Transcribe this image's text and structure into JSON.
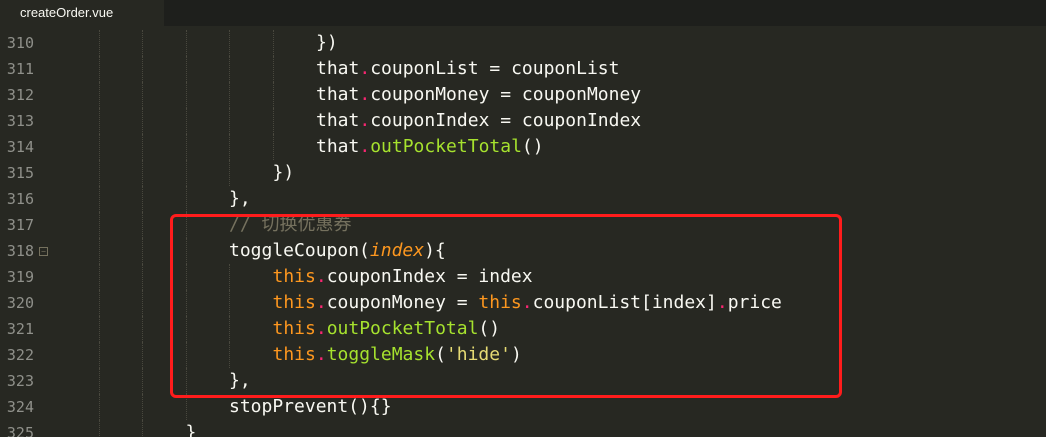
{
  "tab": {
    "label": "createOrder.vue"
  },
  "line_numbers": [
    "310",
    "311",
    "312",
    "313",
    "314",
    "315",
    "316",
    "317",
    "318",
    "319",
    "320",
    "321",
    "322",
    "323",
    "324",
    "325"
  ],
  "fold_line": "318",
  "colors": {
    "background": "#272822",
    "highlight_border": "#ff1c1c",
    "keyword": "#fd971f",
    "function": "#a6e22e",
    "operator": "#f92672",
    "string": "#e6db74",
    "comment": "#75715e"
  },
  "code_lines": [
    {
      "indent": 6,
      "tokens": [
        {
          "t": "plain",
          "v": "})"
        }
      ]
    },
    {
      "indent": 6,
      "tokens": [
        {
          "t": "plain",
          "v": "that"
        },
        {
          "t": "punct",
          "v": "."
        },
        {
          "t": "plain",
          "v": "couponList = couponList"
        }
      ]
    },
    {
      "indent": 6,
      "tokens": [
        {
          "t": "plain",
          "v": "that"
        },
        {
          "t": "punct",
          "v": "."
        },
        {
          "t": "plain",
          "v": "couponMoney = couponMoney"
        }
      ]
    },
    {
      "indent": 6,
      "tokens": [
        {
          "t": "plain",
          "v": "that"
        },
        {
          "t": "punct",
          "v": "."
        },
        {
          "t": "plain",
          "v": "couponIndex = couponIndex"
        }
      ]
    },
    {
      "indent": 6,
      "tokens": [
        {
          "t": "plain",
          "v": "that"
        },
        {
          "t": "punct",
          "v": "."
        },
        {
          "t": "func",
          "v": "outPocketTotal"
        },
        {
          "t": "plain",
          "v": "()"
        }
      ]
    },
    {
      "indent": 5,
      "tokens": [
        {
          "t": "plain",
          "v": "})"
        }
      ]
    },
    {
      "indent": 4,
      "tokens": [
        {
          "t": "plain",
          "v": "},"
        }
      ]
    },
    {
      "indent": 4,
      "tokens": [
        {
          "t": "comment",
          "v": "// 切换优惠券"
        }
      ]
    },
    {
      "indent": 4,
      "tokens": [
        {
          "t": "plain",
          "v": "toggleCoupon("
        },
        {
          "t": "param",
          "v": "index"
        },
        {
          "t": "plain",
          "v": "){"
        }
      ]
    },
    {
      "indent": 5,
      "tokens": [
        {
          "t": "keyword",
          "v": "this"
        },
        {
          "t": "punct",
          "v": "."
        },
        {
          "t": "plain",
          "v": "couponIndex = index"
        }
      ]
    },
    {
      "indent": 5,
      "tokens": [
        {
          "t": "keyword",
          "v": "this"
        },
        {
          "t": "punct",
          "v": "."
        },
        {
          "t": "plain",
          "v": "couponMoney = "
        },
        {
          "t": "keyword",
          "v": "this"
        },
        {
          "t": "punct",
          "v": "."
        },
        {
          "t": "plain",
          "v": "couponList[index]"
        },
        {
          "t": "punct",
          "v": "."
        },
        {
          "t": "plain",
          "v": "price"
        }
      ]
    },
    {
      "indent": 5,
      "tokens": [
        {
          "t": "keyword",
          "v": "this"
        },
        {
          "t": "punct",
          "v": "."
        },
        {
          "t": "func",
          "v": "outPocketTotal"
        },
        {
          "t": "plain",
          "v": "()"
        }
      ]
    },
    {
      "indent": 5,
      "tokens": [
        {
          "t": "keyword",
          "v": "this"
        },
        {
          "t": "punct",
          "v": "."
        },
        {
          "t": "func",
          "v": "toggleMask"
        },
        {
          "t": "plain",
          "v": "("
        },
        {
          "t": "string",
          "v": "'hide'"
        },
        {
          "t": "plain",
          "v": ")"
        }
      ]
    },
    {
      "indent": 4,
      "tokens": [
        {
          "t": "plain",
          "v": "},"
        }
      ]
    },
    {
      "indent": 4,
      "tokens": [
        {
          "t": "plain",
          "v": "stopPrevent(){}"
        }
      ]
    },
    {
      "indent": 3,
      "tokens": [
        {
          "t": "plain",
          "v": "}"
        }
      ]
    }
  ]
}
